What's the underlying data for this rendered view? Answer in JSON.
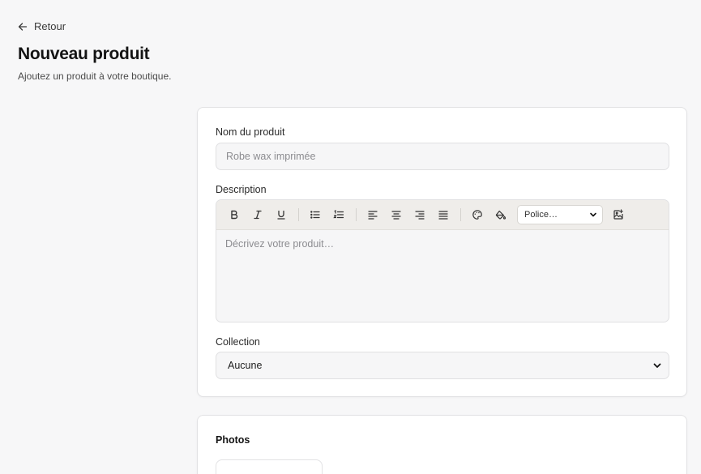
{
  "nav": {
    "back_label": "Retour"
  },
  "header": {
    "title": "Nouveau produit",
    "subtitle": "Ajoutez un produit à votre boutique."
  },
  "form": {
    "name": {
      "label": "Nom du produit",
      "placeholder": "Robe wax imprimée",
      "value": ""
    },
    "description": {
      "label": "Description",
      "placeholder": "Décrivez votre produit…",
      "toolbar": {
        "font_select_value": "Police…",
        "icons": [
          "bold-icon",
          "italic-icon",
          "underline-icon",
          "bullet-list-icon",
          "numbered-list-icon",
          "align-left-icon",
          "align-center-icon",
          "align-right-icon",
          "align-justify-icon",
          "palette-icon",
          "paint-bucket-icon",
          "chevron-down-icon",
          "image-add-icon"
        ]
      }
    },
    "collection": {
      "label": "Collection",
      "value": "Aucune"
    }
  },
  "photos": {
    "title": "Photos"
  },
  "colors": {
    "background": "#f7f7f8",
    "card": "#ffffff",
    "toolbar": "#efedea",
    "input": "#f6f6f7"
  }
}
